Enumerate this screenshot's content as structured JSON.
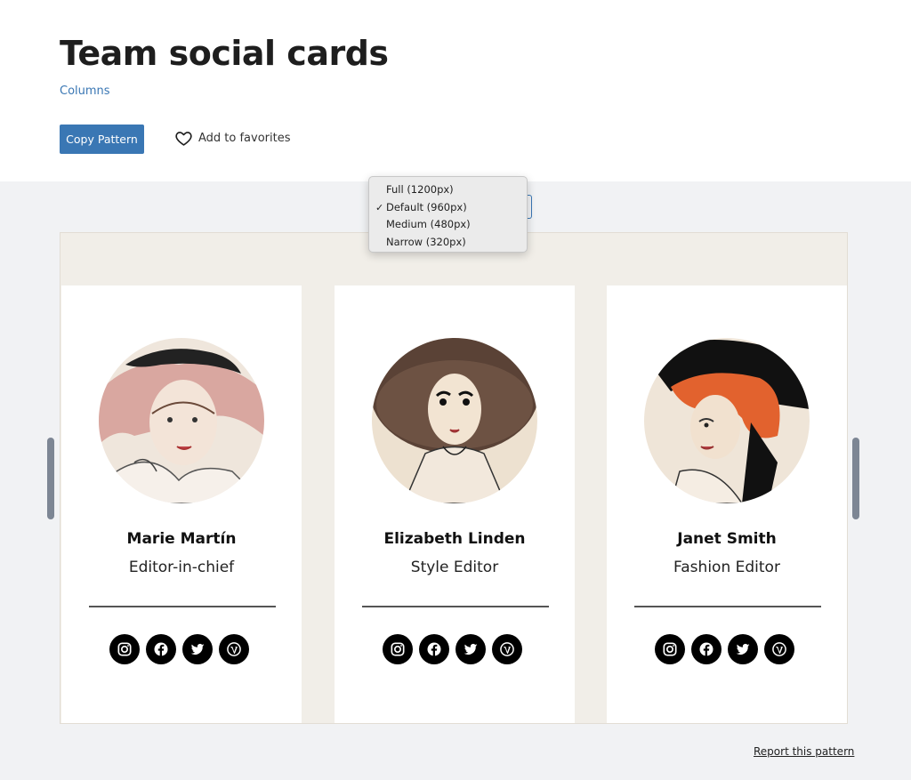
{
  "header": {
    "title": "Team social cards",
    "category": "Columns",
    "copy_label": "Copy Pattern",
    "favorite_label": "Add to favorites"
  },
  "width_menu": {
    "options": [
      {
        "label": "Full (1200px)",
        "selected": false
      },
      {
        "label": "Default (960px)",
        "selected": true
      },
      {
        "label": "Medium (480px)",
        "selected": false
      },
      {
        "label": "Narrow (320px)",
        "selected": false
      }
    ],
    "check_glyph": "✓"
  },
  "cards": [
    {
      "name": "Marie Martín",
      "role": "Editor-in-chief",
      "socials": [
        "instagram-icon",
        "facebook-icon",
        "twitter-icon",
        "wordpress-icon"
      ]
    },
    {
      "name": "Elizabeth Linden",
      "role": "Style Editor",
      "socials": [
        "instagram-icon",
        "facebook-icon",
        "twitter-icon",
        "wordpress-icon"
      ]
    },
    {
      "name": "Janet Smith",
      "role": "Fashion Editor",
      "socials": [
        "instagram-icon",
        "facebook-icon",
        "twitter-icon",
        "wordpress-icon"
      ]
    }
  ],
  "footer": {
    "report_label": "Report this pattern"
  },
  "colors": {
    "accent": "#3a77b4",
    "stage_bg": "#f1f2f4",
    "preview_bg": "#f1eee8"
  }
}
